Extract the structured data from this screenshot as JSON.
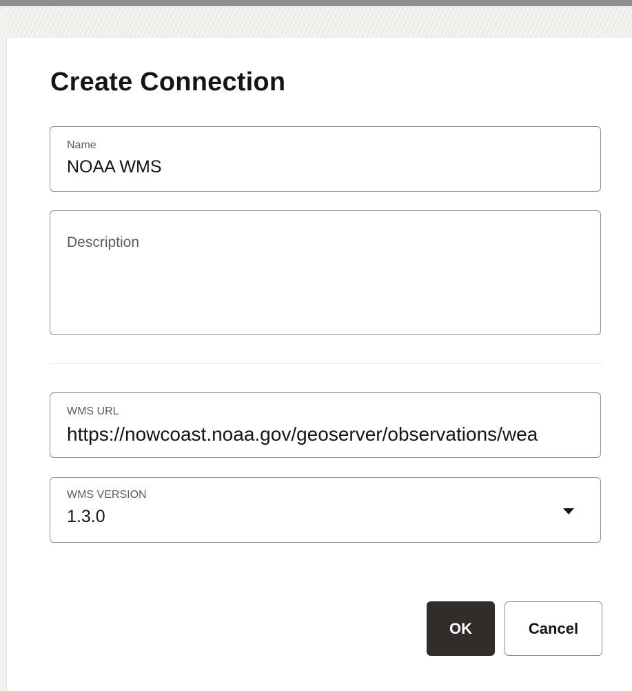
{
  "dialog": {
    "title": "Create Connection"
  },
  "form": {
    "name": {
      "label": "Name",
      "value": "NOAA WMS"
    },
    "description": {
      "label": "Description",
      "value": ""
    },
    "wms_url": {
      "label": "WMS URL",
      "value": "https://nowcoast.noaa.gov/geoserver/observations/wea"
    },
    "wms_version": {
      "label": "WMS VERSION",
      "value": "1.3.0",
      "icon": "chevron-down-icon"
    }
  },
  "actions": {
    "ok_label": "OK",
    "cancel_label": "Cancel"
  },
  "colors": {
    "primary_button_bg": "#312d2a",
    "text": "#161513",
    "label": "#5f5b57",
    "border": "#8e8c89"
  }
}
